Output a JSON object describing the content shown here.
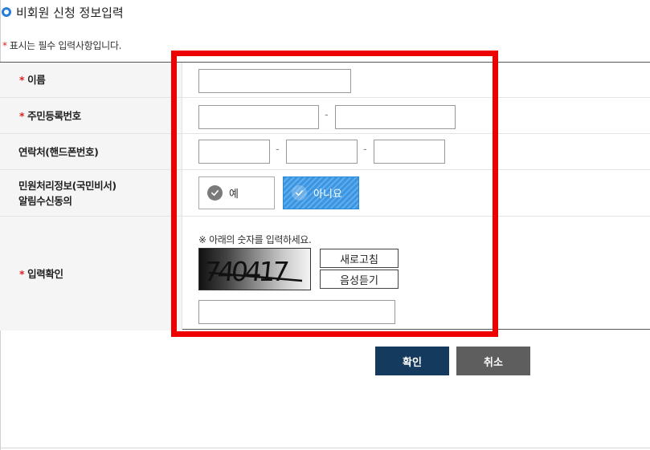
{
  "page": {
    "title": "비회원 신청 정보입력",
    "required_note": "표시는 필수 입력사항입니다.",
    "required_mark": "*"
  },
  "form": {
    "name": {
      "label": "이름",
      "value": ""
    },
    "resident_number": {
      "label": "주민등록번호",
      "part1": "",
      "part2": "",
      "separator": "-"
    },
    "contact": {
      "label": "연락처(핸드폰번호)",
      "part1": "",
      "part2": "",
      "part3": "",
      "separator": "-"
    },
    "notification_consent": {
      "label_line1": "민원처리정보(국민비서)",
      "label_line2": "알림수신동의",
      "options": [
        {
          "label": "예",
          "selected": false
        },
        {
          "label": "아니요",
          "selected": true
        }
      ]
    },
    "captcha": {
      "label": "입력확인",
      "guide": "※ 아래의 숫자를 입력하세요.",
      "image_text": "740417",
      "refresh_label": "새로고침",
      "audio_label": "음성듣기",
      "value": ""
    }
  },
  "actions": {
    "confirm_label": "확인",
    "cancel_label": "취소"
  },
  "colors": {
    "accent_blue": "#2a8ad9",
    "required_red": "#dd2222",
    "highlight_red": "#ee0000",
    "confirm_bg": "#143a5e",
    "cancel_bg": "#5e5e5e"
  }
}
